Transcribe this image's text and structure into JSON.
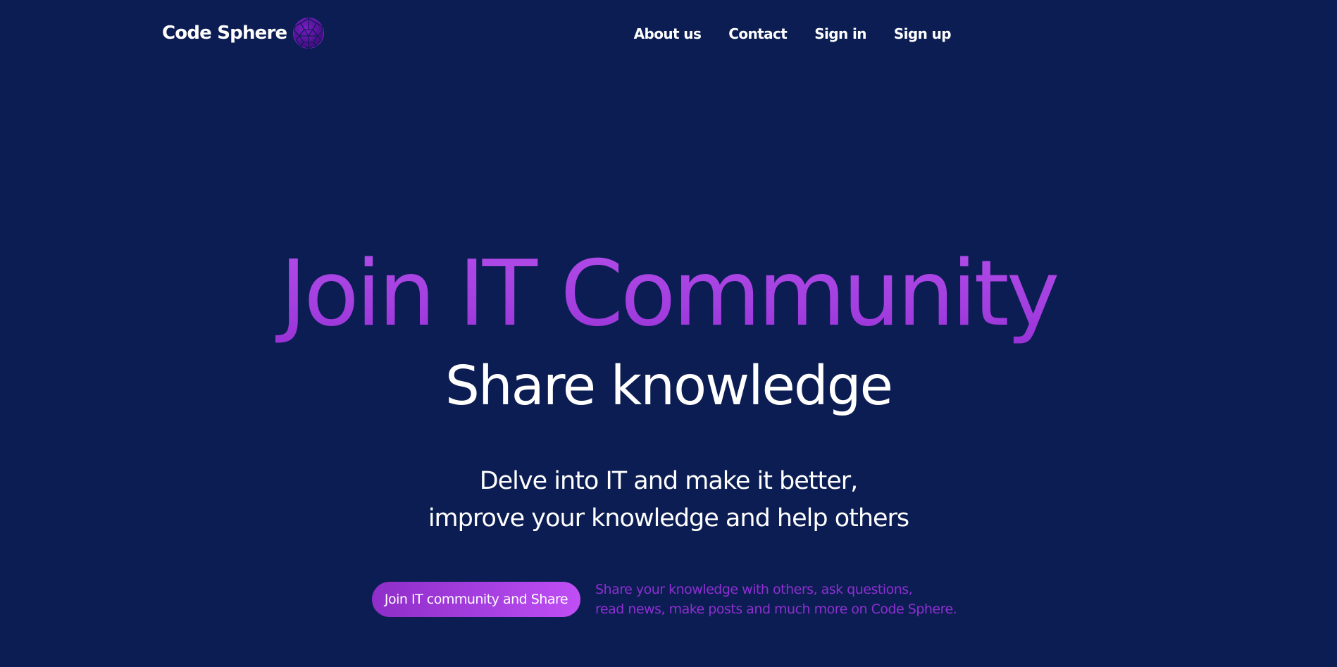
{
  "app": {
    "brand_name": "Code Sphere",
    "logo_icon": "geodesic-sphere-icon"
  },
  "nav": {
    "items": [
      {
        "label": "About us"
      },
      {
        "label": "Contact"
      },
      {
        "label": "Sign in"
      },
      {
        "label": "Sign up"
      }
    ]
  },
  "hero": {
    "title": "Join IT Community",
    "subtitle": "Share knowledge",
    "description_lines": [
      "Delve into IT and make it better,",
      "improve your knowledge and help others"
    ],
    "cta_label": "Join IT community and Share",
    "cta_note_lines": [
      "Share your knowledge with others, ask questions,",
      "read news, make posts and much more on Code Sphere."
    ]
  },
  "colors": {
    "background": "#0b1d52",
    "accent": "#a43fe0",
    "note_text": "#8e2fd0",
    "text": "#ffffff"
  }
}
